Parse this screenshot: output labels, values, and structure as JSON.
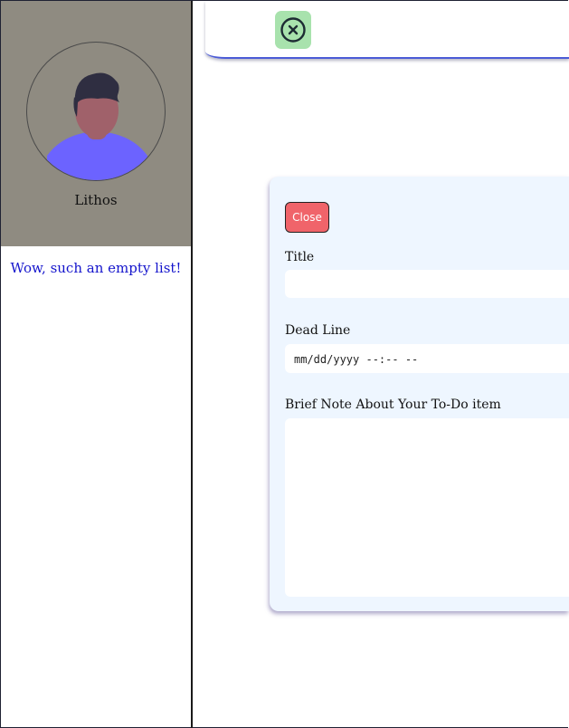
{
  "sidebar": {
    "username": "Lithos",
    "empty_message": "Wow, such an empty list!"
  },
  "header": {
    "close_icon": "circle-x-icon"
  },
  "form": {
    "close_label": "Close",
    "title_label": "Title",
    "title_value": "",
    "deadline_label": "Dead Line",
    "deadline_placeholder": "mm/dd/yyyy --:-- --",
    "note_label": "Brief Note About Your To-Do item",
    "note_value": ""
  },
  "colors": {
    "profile_bg": "#8f8b81",
    "avatar_shirt": "#6c63ff",
    "avatar_skin": "#a0616a",
    "avatar_hair": "#2f2e41",
    "header_button_bg": "#a8e2ad",
    "close_button_bg": "#f0646a",
    "form_bg": "#eef6ff",
    "empty_message_color": "#1414cc"
  }
}
